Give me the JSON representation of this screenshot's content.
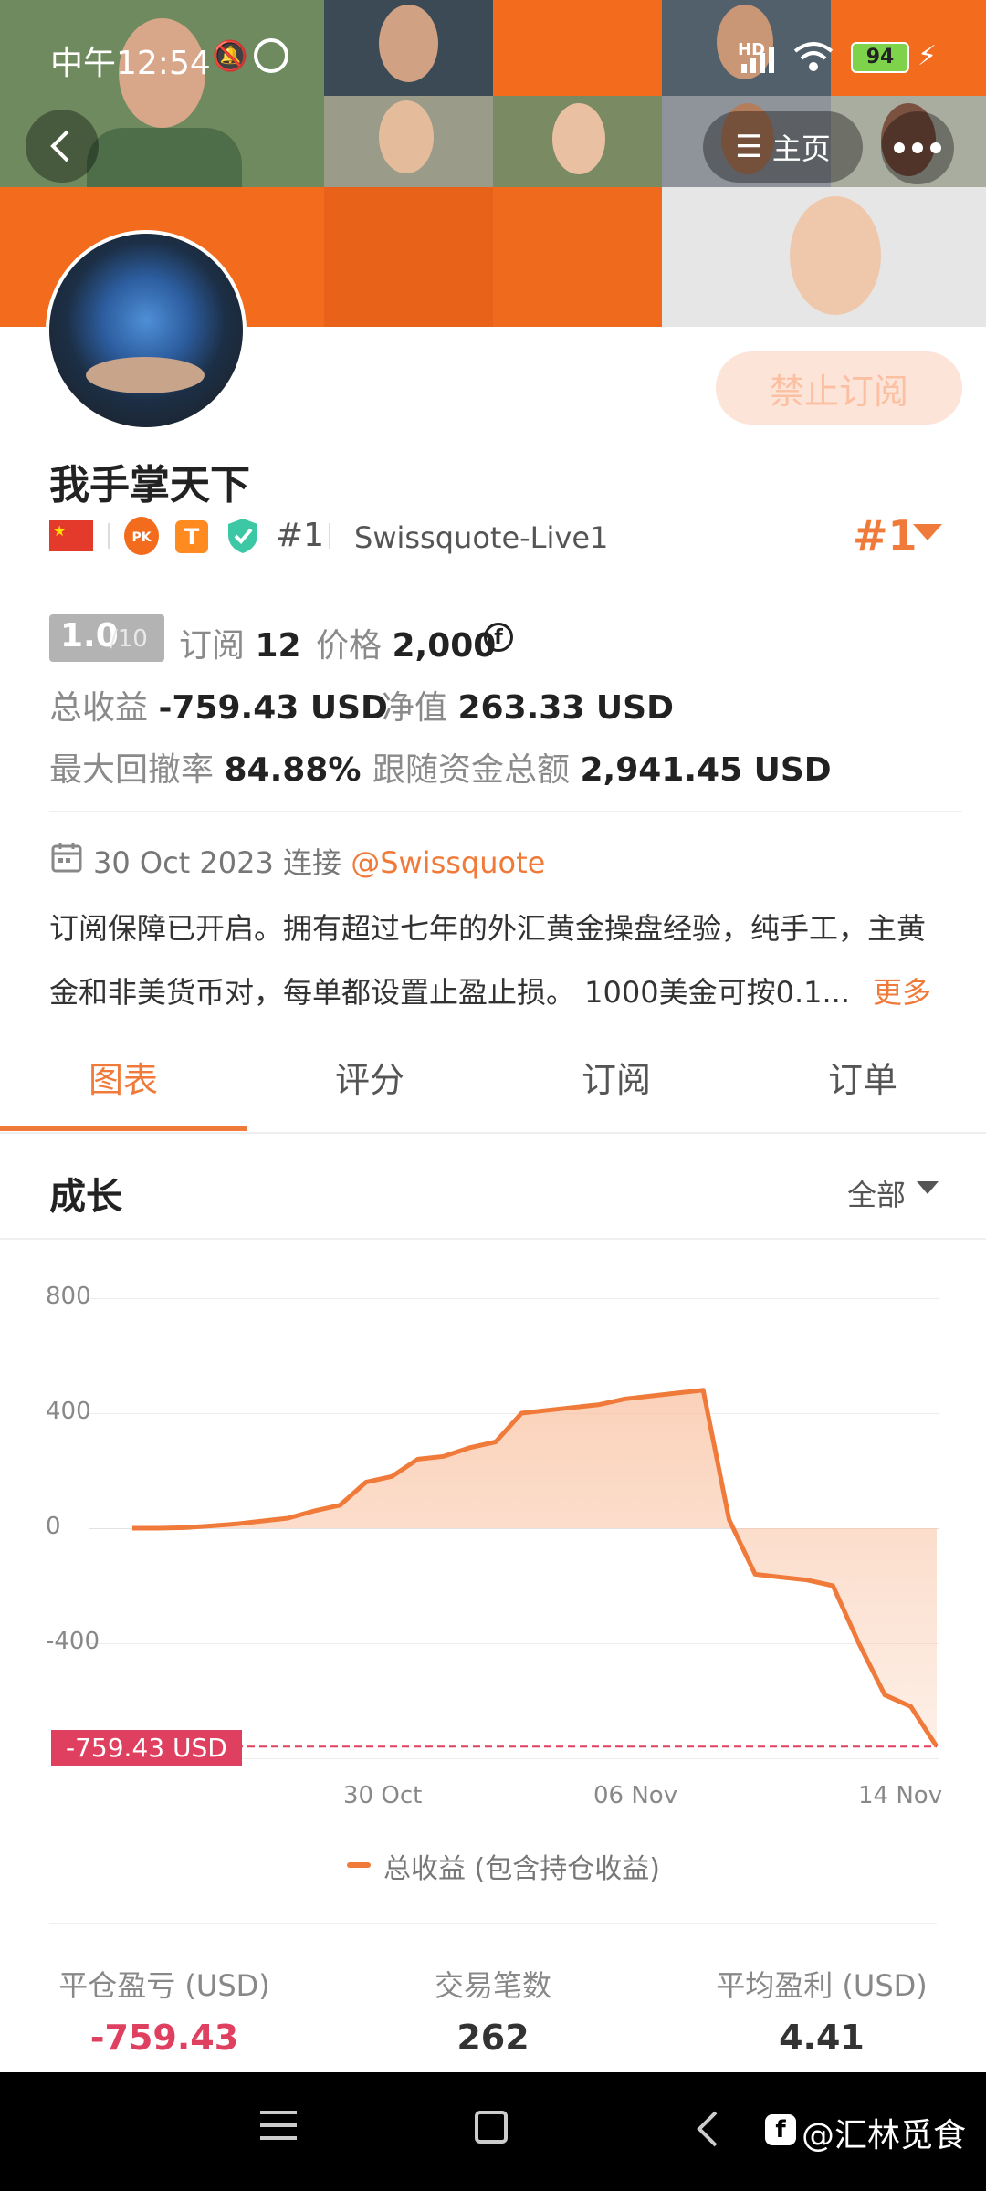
{
  "status_bar": {
    "time": "中午12:54",
    "battery": "94",
    "signal_label": "HD"
  },
  "header": {
    "home_label": "主页"
  },
  "profile": {
    "name": "我手掌天下",
    "pk_label": "PK",
    "t_label": "T",
    "rank": "#1",
    "broker": "Swissquote-Live1",
    "rank_right": "#1",
    "subscribe_button": "禁止订阅"
  },
  "stats": {
    "score_main": "1.0",
    "score_total": "/10",
    "subs_label": "订阅",
    "subs_value": "12",
    "price_label": "价格",
    "price_value": "2,000",
    "profit_label": "总收益",
    "profit_value": "-759.43 USD",
    "equity_label": "净值",
    "equity_value": "263.33 USD",
    "drawdown_label": "最大回撤率",
    "drawdown_value": "84.88%",
    "follow_label": "跟随资金总额",
    "follow_value": "2,941.45 USD"
  },
  "info": {
    "date": "30 Oct 2023",
    "connect_label": "连接",
    "broker_link": "@Swissquote",
    "desc_line1": "订阅保障已开启。拥有超过七年的外汇黄金操盘经验，纯手工，主黄",
    "desc_line2": "金和非美货币对，每单都设置止盈止损。 1000美金可按0.1...",
    "more": "更多"
  },
  "tabs": [
    "图表",
    "评分",
    "订阅",
    "订单"
  ],
  "growth": {
    "title": "成长",
    "filter": "全部"
  },
  "chart_data": {
    "type": "area",
    "y_ticks": [
      "800",
      "400",
      "0",
      "-400"
    ],
    "ylim": [
      -800,
      800
    ],
    "x_ticks": [
      "30 Oct",
      "06 Nov",
      "14 Nov"
    ],
    "series": [
      {
        "name": "总收益 (包含持仓收益)",
        "values": [
          0,
          0,
          2,
          8,
          15,
          25,
          35,
          60,
          80,
          160,
          180,
          240,
          250,
          280,
          300,
          400,
          410,
          420,
          430,
          450,
          460,
          470,
          480,
          30,
          -160,
          -170,
          -180,
          -200,
          -400,
          -580,
          -620,
          -759.43
        ]
      }
    ],
    "current_label": "-759.43 USD",
    "colors": {
      "line": "#f07a3a",
      "fill": "#f9c2a2",
      "marker": "#e0405f"
    }
  },
  "summary": {
    "closed_pl_label": "平仓盈亏 (USD)",
    "closed_pl_value": "-759.43",
    "trades_label": "交易笔数",
    "trades_value": "262",
    "avg_label": "平均盈利 (USD)",
    "avg_value": "4.41"
  },
  "watermark": "@汇林觅食"
}
